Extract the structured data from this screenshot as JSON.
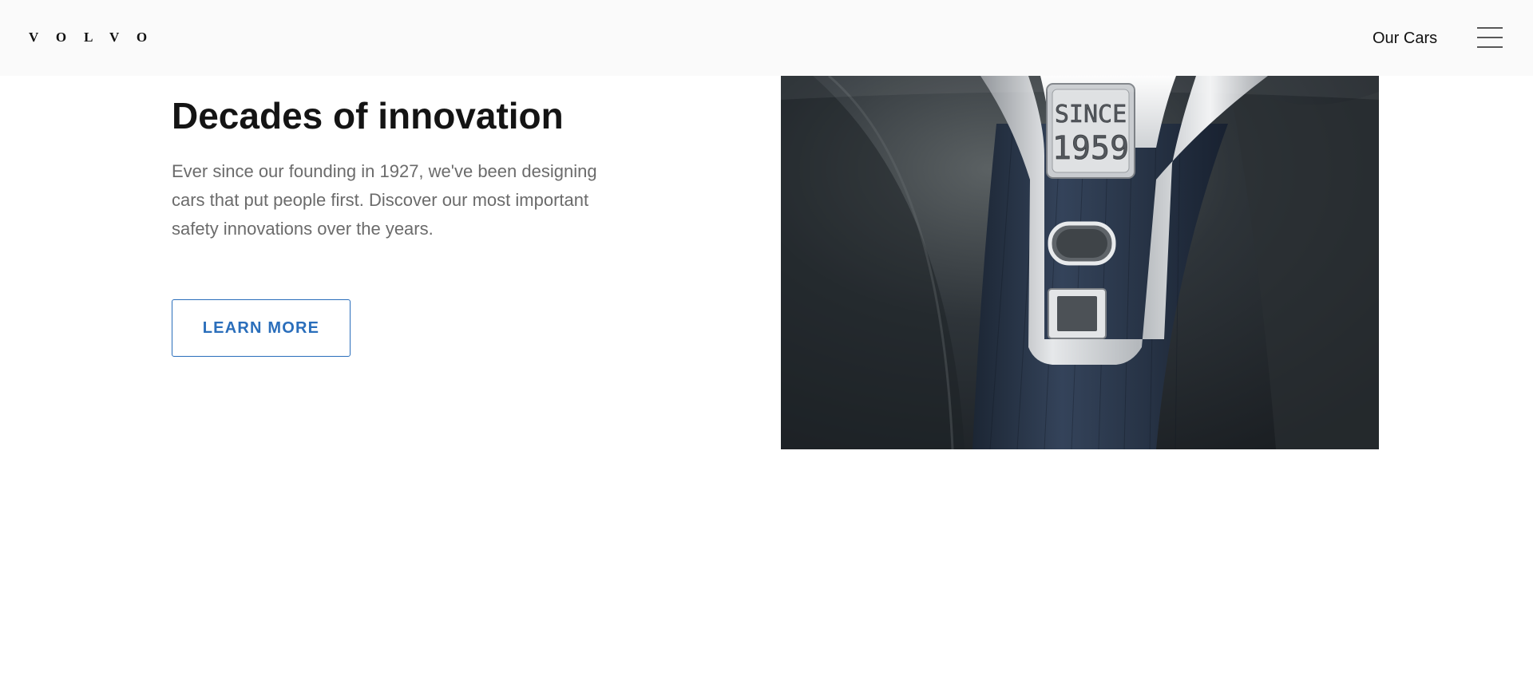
{
  "header": {
    "logo_text": "VOLVO",
    "nav_link": "Our Cars",
    "menu_icon": "hamburger-menu-icon"
  },
  "main": {
    "headline": "Decades of innovation",
    "description": "Ever since our founding in 1927, we've been designing cars that put people first. Discover our most important safety innovations over the years.",
    "cta_label": "LEARN MORE"
  },
  "image": {
    "subject": "seatbelt-buckle-photo",
    "engraving_line1": "SINCE",
    "engraving_line2": "1959"
  },
  "colors": {
    "header_bg": "#fafafa",
    "accent": "#2a6ebb",
    "headline": "#141414",
    "body_text": "#6b6b6b"
  }
}
